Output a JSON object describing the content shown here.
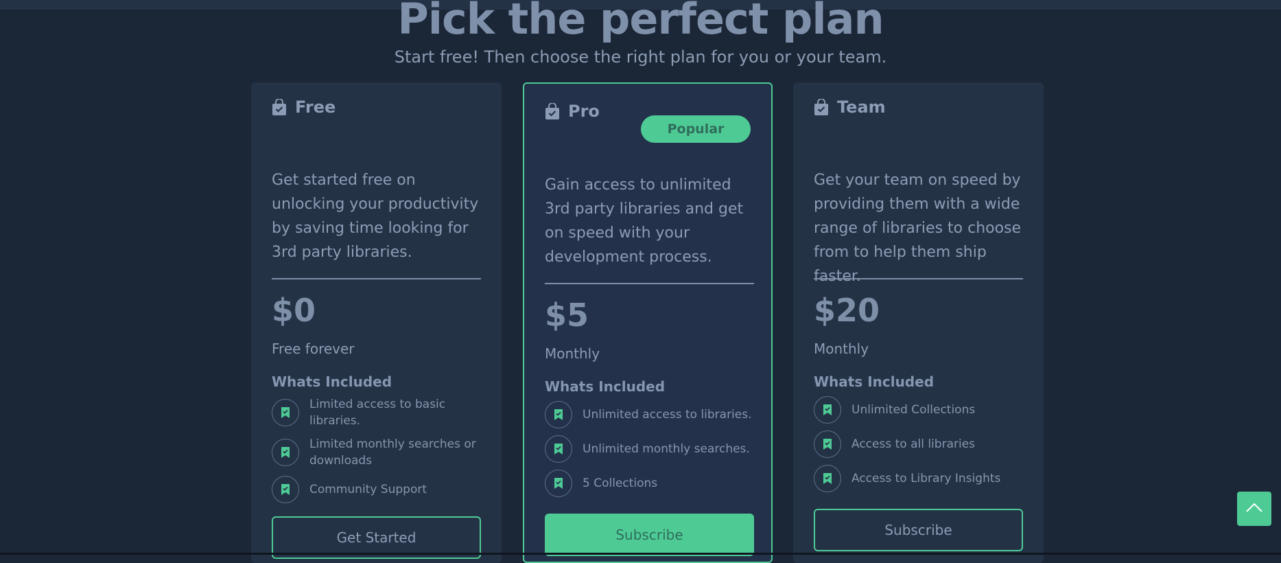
{
  "page": {
    "title": "Pick the perfect plan",
    "subtitle": "Start free! Then choose the right plan for you or your team."
  },
  "plans": [
    {
      "name": "Free",
      "description": "Get started free on unlocking your productivity by saving time looking for 3rd party libraries.",
      "price": "$0",
      "period": "Free forever",
      "included_label": "Whats Included",
      "features": [
        "Limited access to basic libraries.",
        "Limited monthly searches or downloads",
        "Community Support"
      ],
      "button_label": "Get Started"
    },
    {
      "name": "Pro",
      "badge": "Popular",
      "description": "Gain access to unlimited 3rd party libraries and get on speed with your development process.",
      "price": "$5",
      "period": "Monthly",
      "included_label": "Whats Included",
      "features": [
        "Unlimited access to libraries.",
        "Unlimited monthly searches.",
        "5 Collections"
      ],
      "button_label": "Subscribe"
    },
    {
      "name": "Team",
      "description": "Get your team on speed by providing them with a wide range of libraries to choose from to help them ship faster.",
      "price": "$20",
      "period": "Monthly",
      "included_label": "Whats Included",
      "features": [
        "Unlimited Collections",
        "Access to all libraries",
        "Access to Library Insights"
      ],
      "button_label": "Subscribe"
    }
  ],
  "icons": {
    "plan": "shopping-bag-check-icon",
    "feature": "bookmark-check-icon",
    "scroll_top": "chevron-up-icon"
  },
  "colors": {
    "background": "#1b2637",
    "card": "#243246",
    "accent": "#4ecb95",
    "text": "#8d9db4"
  }
}
